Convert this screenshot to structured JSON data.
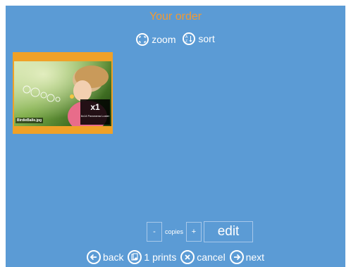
{
  "header": {
    "title": "Your order"
  },
  "toolbar": {
    "zoom_label": "zoom",
    "sort_label": "sort",
    "zoom_icon": "zoom-frame-icon",
    "sort_icon": "sort-az-icon"
  },
  "items": [
    {
      "filename": "BirdieBalle.jpg",
      "quantity": "x1",
      "description": "6x14 Panorama Luster"
    }
  ],
  "copies": {
    "minus_label": "-",
    "label": "copies",
    "plus_label": "+",
    "edit_label": "edit"
  },
  "footer": {
    "back_label": "back",
    "prints_label": "1 prints",
    "cancel_label": "cancel",
    "next_label": "next"
  },
  "colors": {
    "background": "#5b9bd5",
    "title": "#f29a32",
    "thumbnail_frame": "#f0a127"
  }
}
